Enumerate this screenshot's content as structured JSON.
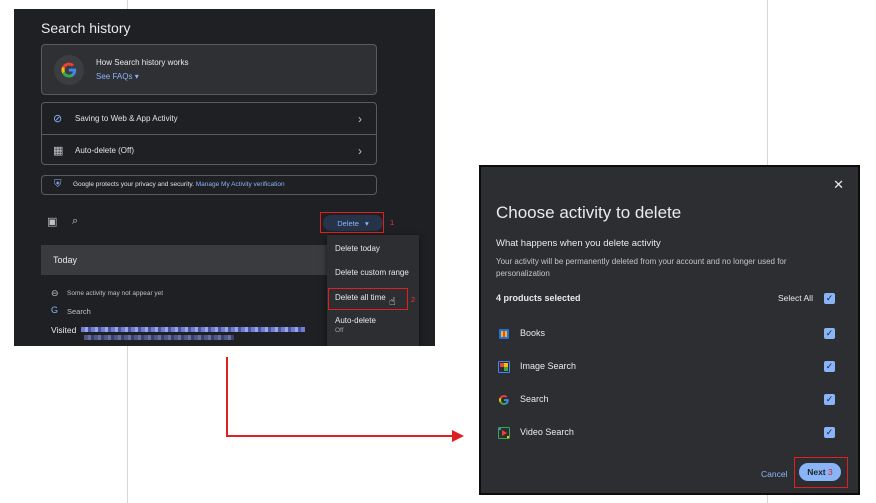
{
  "left_panel": {
    "title": "Search history",
    "faq": {
      "title": "How Search history works",
      "link": "See FAQs"
    },
    "settings": [
      {
        "label": "Saving to Web & App Activity"
      },
      {
        "label": "Auto-delete (Off)"
      }
    ],
    "privacy": {
      "text": "Google protects your privacy and security.",
      "link": "Manage My Activity verification"
    },
    "delete_button": "Delete",
    "today_label": "Today",
    "menu": [
      {
        "label": "Delete today"
      },
      {
        "label": "Delete custom range"
      },
      {
        "label": "Delete all time"
      },
      {
        "label": "Auto-delete",
        "sub": "Off"
      }
    ],
    "note": "Some activity may not appear yet",
    "search_label": "Search",
    "visited_label": "Visited",
    "step_numbers": [
      "1",
      "2"
    ]
  },
  "dialog": {
    "title": "Choose activity to delete",
    "subtitle": "What happens when you delete activity",
    "description": "Your activity will be permanently deleted from your account and no longer used for personalization",
    "count_label": "4 products selected",
    "select_all": "Select All",
    "products": [
      {
        "label": "Books",
        "icon": "books-icon"
      },
      {
        "label": "Image Search",
        "icon": "image-search-icon"
      },
      {
        "label": "Search",
        "icon": "google-g-icon"
      },
      {
        "label": "Video Search",
        "icon": "video-search-icon"
      }
    ],
    "cancel": "Cancel",
    "next": "Next",
    "step_number": "3"
  },
  "colors": {
    "accent": "#8ab4f8",
    "dark_bg": "#1f2023",
    "dialog_bg": "#2d2e31",
    "highlight_red": "#e02020"
  }
}
